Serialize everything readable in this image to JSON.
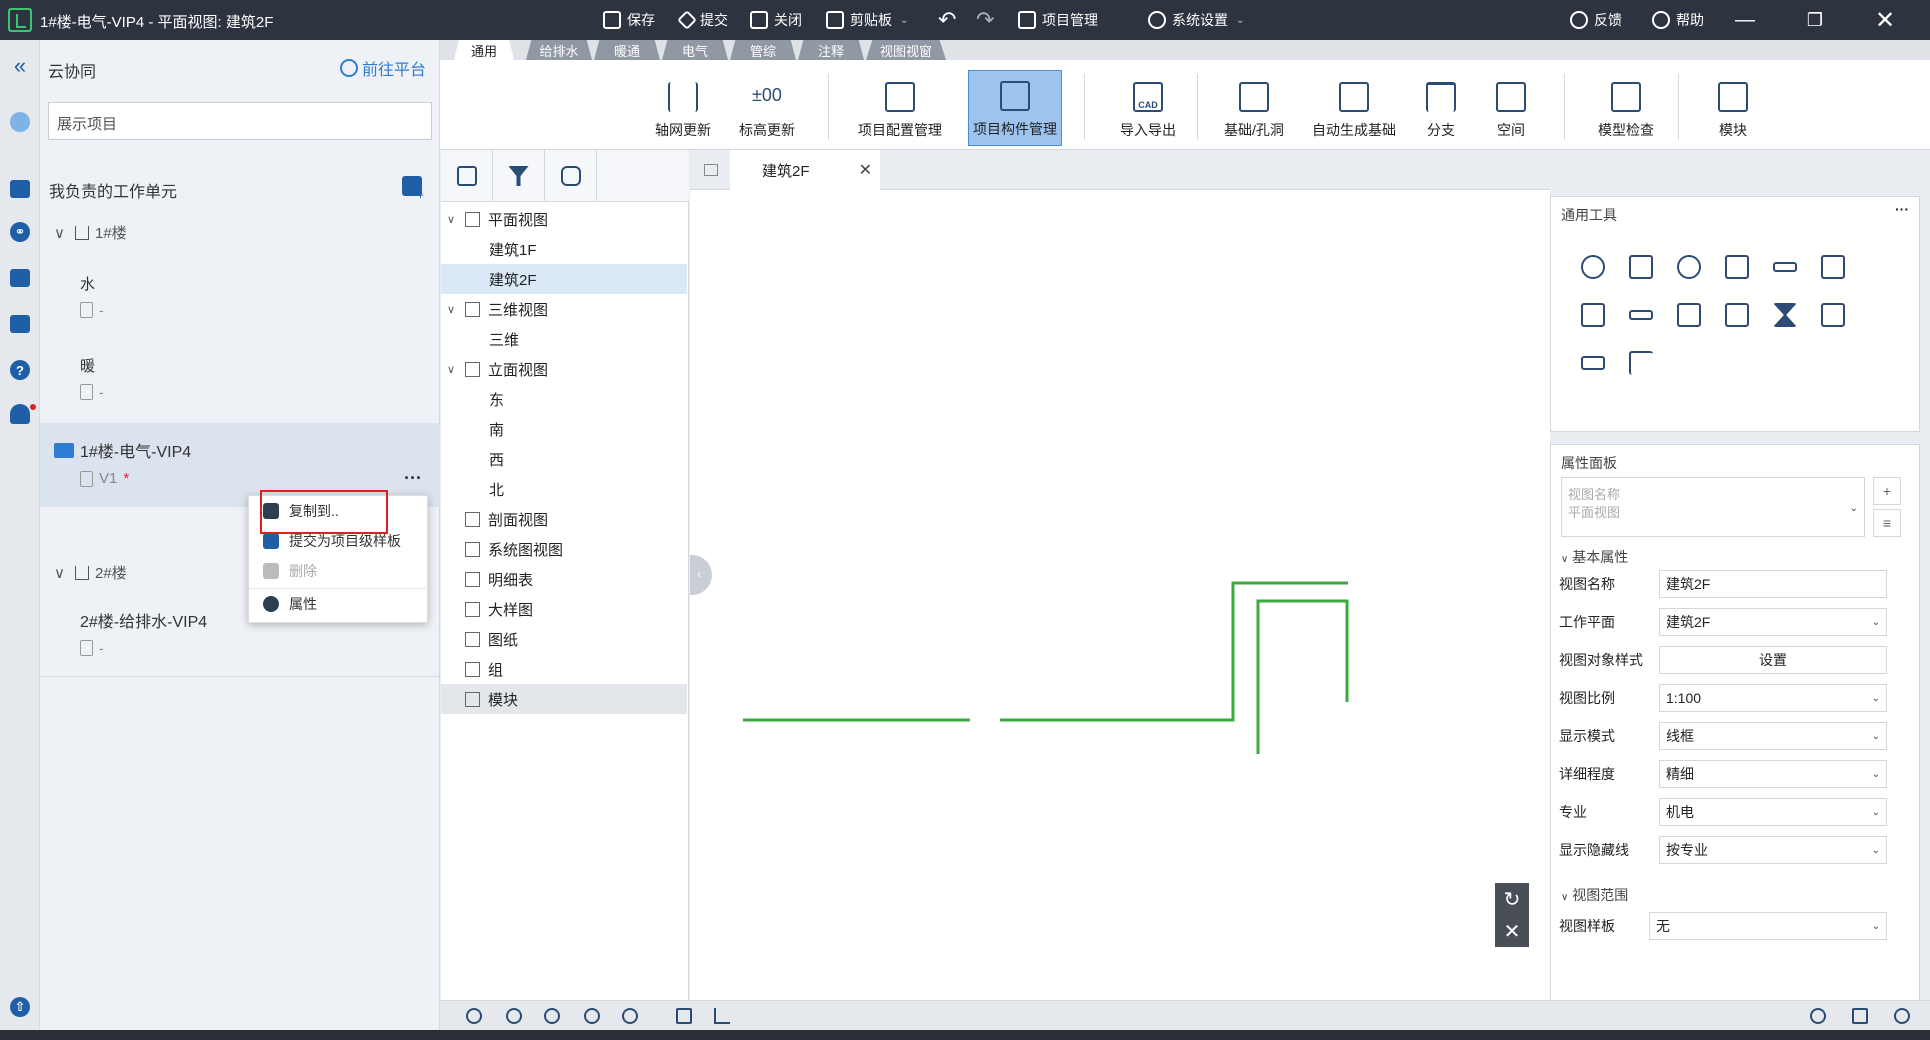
{
  "app": {
    "title": "1#楼-电气-VIP4 - 平面视图: 建筑2F"
  },
  "titlebar": {
    "save": "保存",
    "submit": "提交",
    "close": "关闭",
    "clipboard": "剪贴板",
    "project_mgmt": "项目管理",
    "system_settings": "系统设置",
    "feedback": "反馈",
    "help": "帮助"
  },
  "left": {
    "title": "云协同",
    "goto_platform": "前往平台",
    "search_placeholder": "展示项目",
    "my_units": "我负责的工作单元",
    "building1": "1#楼",
    "water": "水",
    "dash1": "-",
    "heating": "暖",
    "dash2": "-",
    "elec_unit": "1#楼-电气-VIP4",
    "version": "V1",
    "version_mark": "*",
    "building2": "2#楼",
    "plumbing_unit": "2#楼-给排水-VIP4",
    "dash3": "-",
    "more": "···"
  },
  "context_menu": {
    "copy_to": "复制到..",
    "submit_template": "提交为项目级样板",
    "delete": "删除",
    "properties": "属性"
  },
  "ribbon": {
    "tabs": [
      "通用",
      "给排水",
      "暖通",
      "电气",
      "管综",
      "注释",
      "视图视窗"
    ],
    "buttons": {
      "grid_update": "轴网更新",
      "level_update": "标高更新",
      "level_glyph": "±00",
      "project_config": "项目配置管理",
      "project_component": "项目构件管理",
      "import_export": "导入导出",
      "cad": "CAD",
      "foundation_hole": "基础/孔洞",
      "auto_foundation": "自动生成基础",
      "branch": "分支",
      "space": "空间",
      "model_check": "模型检查",
      "module": "模块"
    }
  },
  "tree": {
    "plan_views": "平面视图",
    "b1f": "建筑1F",
    "b2f": "建筑2F",
    "views_3d": "三维视图",
    "v3d": "三维",
    "elevations": "立面视图",
    "east": "东",
    "south": "南",
    "west": "西",
    "north": "北",
    "sections": "剖面视图",
    "system_views": "系统图视图",
    "schedules": "明细表",
    "details": "大样图",
    "sheets": "图纸",
    "groups": "组",
    "modules": "模块"
  },
  "canvas": {
    "tab_label": "建筑2F"
  },
  "tools_panel": {
    "title": "通用工具",
    "more": "···"
  },
  "props": {
    "title": "属性面板",
    "selector_line1": "视图名称",
    "selector_line2": "平面视图",
    "section_basic": "基本属性",
    "section_range": "视图范围",
    "rows": {
      "view_name_label": "视图名称",
      "view_name": "建筑2F",
      "work_plane_label": "工作平面",
      "work_plane": "建筑2F",
      "obj_style_label": "视图对象样式",
      "obj_style": "设置",
      "scale_label": "视图比例",
      "scale": "1:100",
      "display_label": "显示模式",
      "display": "线框",
      "detail_label": "详细程度",
      "detail": "精细",
      "discipline_label": "专业",
      "discipline": "机电",
      "hidden_label": "显示隐藏线",
      "hidden": "按专业",
      "template_label": "视图样板",
      "template": "无"
    }
  },
  "colors": {
    "accent": "#1f5fa8",
    "active_button": "#9dc3ef",
    "pipe_green": "#3da83d",
    "highlight_red": "#e02020"
  }
}
